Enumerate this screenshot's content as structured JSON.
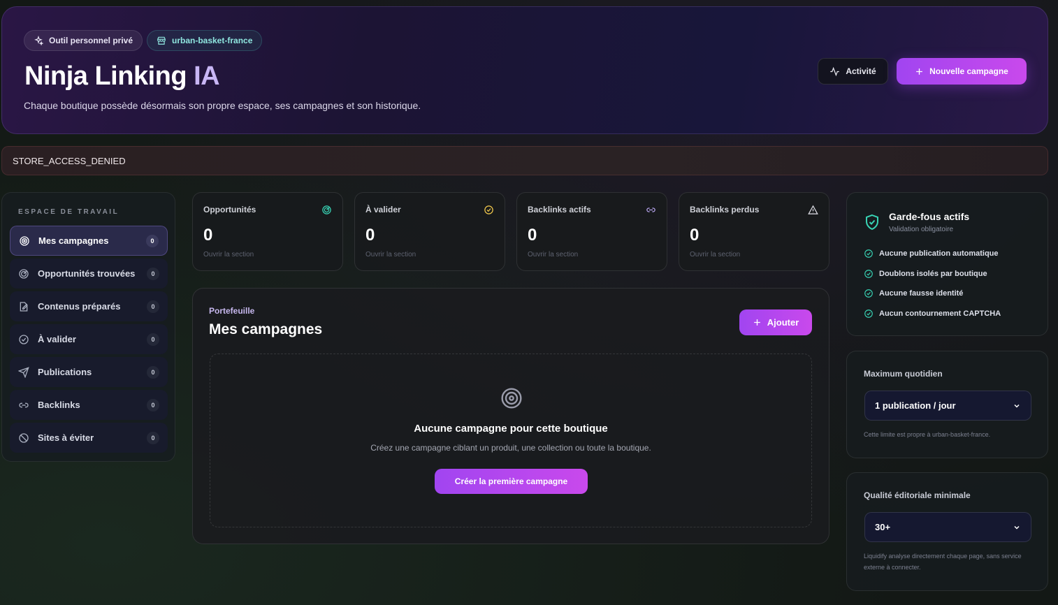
{
  "header": {
    "badge_private": "Outil personnel privé",
    "badge_store": "urban-basket-france",
    "title_main": "Ninja Linking",
    "title_accent": "IA",
    "subtitle": "Chaque boutique possède désormais son propre espace, ses campagnes et son historique.",
    "activity_label": "Activité",
    "new_campaign_label": "Nouvelle campagne"
  },
  "alert": {
    "text": "STORE_ACCESS_DENIED"
  },
  "sidebar": {
    "heading": "ESPACE DE TRAVAIL",
    "items": [
      {
        "label": "Mes campagnes",
        "count": "0",
        "icon": "target-icon"
      },
      {
        "label": "Opportunités trouvées",
        "count": "0",
        "icon": "radar-icon"
      },
      {
        "label": "Contenus préparés",
        "count": "0",
        "icon": "edit-icon"
      },
      {
        "label": "À valider",
        "count": "0",
        "icon": "check-circle-icon"
      },
      {
        "label": "Publications",
        "count": "0",
        "icon": "send-icon"
      },
      {
        "label": "Backlinks",
        "count": "0",
        "icon": "link-icon"
      },
      {
        "label": "Sites à éviter",
        "count": "0",
        "icon": "ban-icon"
      }
    ]
  },
  "stats": [
    {
      "label": "Opportunités",
      "value": "0",
      "link": "Ouvrir la section",
      "color": "#38d3b4"
    },
    {
      "label": "À valider",
      "value": "0",
      "link": "Ouvrir la section",
      "color": "#f2c94c"
    },
    {
      "label": "Backlinks actifs",
      "value": "0",
      "link": "Ouvrir la section",
      "color": "#b9a6f0"
    },
    {
      "label": "Backlinks perdus",
      "value": "0",
      "link": "Ouvrir la section",
      "color": "#e0e0e8"
    }
  ],
  "portfolio": {
    "kicker": "Portefeuille",
    "title": "Mes campagnes",
    "add_label": "Ajouter",
    "empty_title": "Aucune campagne pour cette boutique",
    "empty_desc": "Créez une campagne ciblant un produit, une collection ou toute la boutique.",
    "empty_cta": "Créer la première campagne"
  },
  "guardrails": {
    "title": "Garde-fous actifs",
    "subtitle": "Validation obligatoire",
    "items": [
      "Aucune publication automatique",
      "Doublons isolés par boutique",
      "Aucune fausse identité",
      "Aucun contournement CAPTCHA"
    ]
  },
  "daily": {
    "label": "Maximum quotidien",
    "value": "1 publication / jour",
    "note": "Cette limite est propre à urban-basket-france."
  },
  "quality": {
    "label": "Qualité éditoriale minimale",
    "value": "30+",
    "note": "Liquidify analyse directement chaque page, sans service externe à connecter."
  }
}
